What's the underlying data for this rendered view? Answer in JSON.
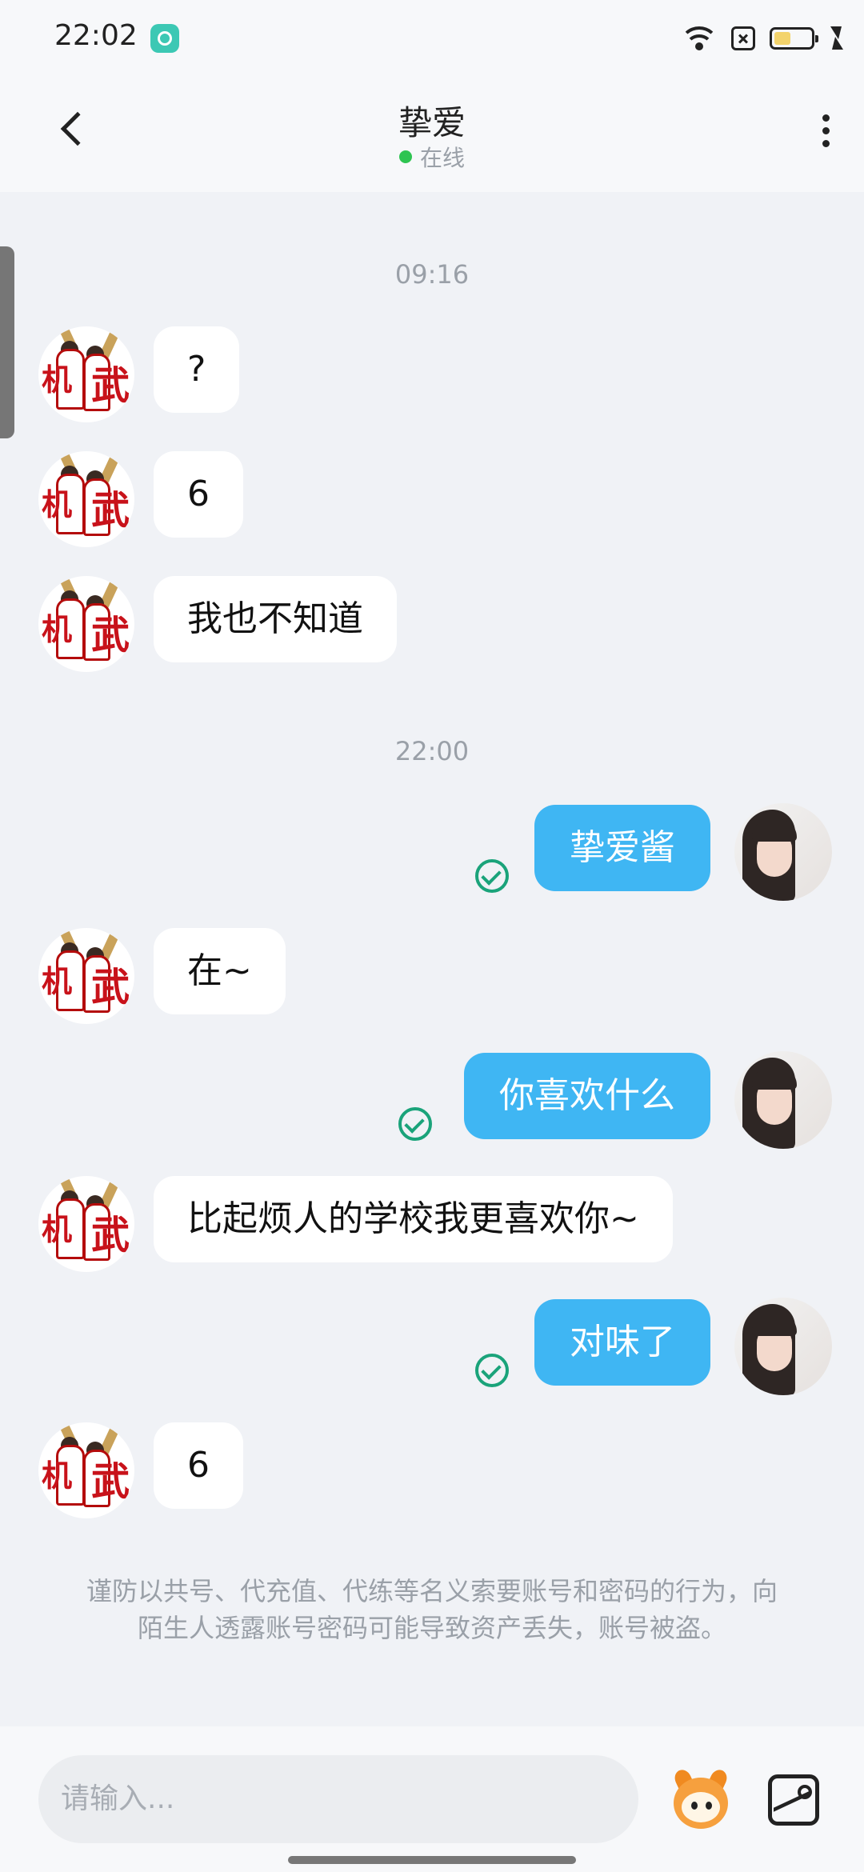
{
  "status_bar": {
    "time": "22:02",
    "icons": [
      "app-notification-icon",
      "wifi-icon",
      "sim-off-icon",
      "battery-icon",
      "charging-icon"
    ]
  },
  "header": {
    "title": "挚爱",
    "status": "在线",
    "status_color": "#2ec451",
    "back_icon": "back-chevron-icon",
    "more_icon": "more-vertical-icon"
  },
  "messages": {
    "ts1": "09:16",
    "m1": "?",
    "m2": "6",
    "m3": "我也不知道",
    "ts2": "22:00",
    "m4": "挚爱酱",
    "m5": "在~",
    "m6": "你喜欢什么",
    "m7": "比起烦人的学校我更喜欢你~",
    "m8": "对味了",
    "m9": "6"
  },
  "warning": "谨防以共号、代充值、代练等名义索要账号和密码的行为，向陌生人透露账号密码可能导致资产丢失，账号被盗。",
  "input": {
    "placeholder": "请输入..."
  },
  "colors": {
    "outgoing_bubble": "#3fb6f3",
    "incoming_bubble": "#ffffff",
    "read_check": "#1aa37a",
    "background": "#f0f2f6"
  }
}
